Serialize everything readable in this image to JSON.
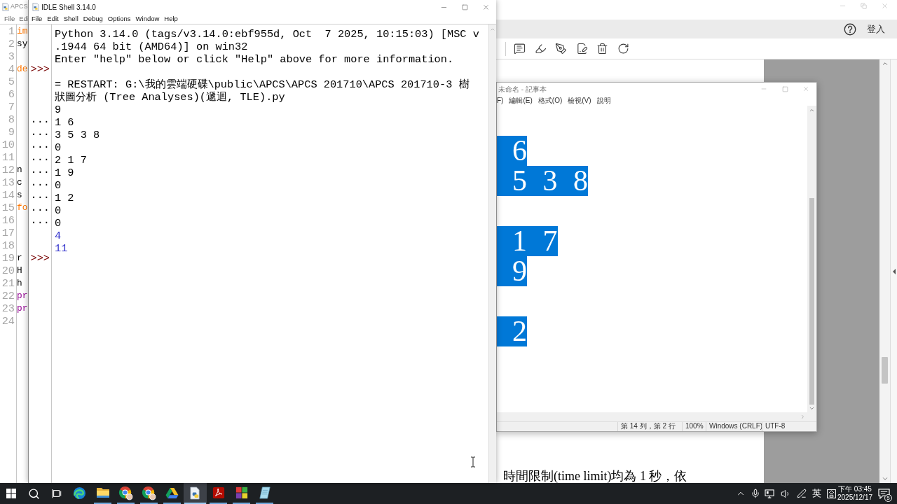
{
  "reader": {
    "account": "登入",
    "page_text": "時間限制(time limit)均為 1 秒，依"
  },
  "notepad": {
    "title": "未命名 - 記事本",
    "menu": [
      "F)",
      "編輯(E)",
      "格式(O)",
      "檢視(V)",
      "說明"
    ],
    "rows": [
      {
        "kind": "blank"
      },
      {
        "kind": "text",
        "text": "6",
        "selected": true
      },
      {
        "kind": "text",
        "text": "5 3 8",
        "selected": true
      },
      {
        "kind": "blank"
      },
      {
        "kind": "text",
        "text": "1 7",
        "selected": true
      },
      {
        "kind": "text",
        "text": "9",
        "selected": true
      },
      {
        "kind": "blank"
      },
      {
        "kind": "text",
        "text": "2",
        "selected": true
      },
      {
        "kind": "blank"
      },
      {
        "kind": "blank"
      }
    ],
    "status": [
      "第 14 列，第 2 行",
      "100%",
      "Windows (CRLF)",
      "UTF-8"
    ]
  },
  "editor_window": {
    "title": "APCS",
    "menu": [
      "File",
      "Edi"
    ],
    "lines": [
      {
        "number": "1",
        "code": "im",
        "kind": "keyword"
      },
      {
        "number": "2",
        "code": "sy",
        "kind": "name"
      },
      {
        "number": "3"
      },
      {
        "number": "4",
        "code": "de",
        "kind": "keyword"
      },
      {
        "number": "5"
      },
      {
        "number": "6"
      },
      {
        "number": "7"
      },
      {
        "number": "8"
      },
      {
        "number": "9"
      },
      {
        "number": "10"
      },
      {
        "number": "11"
      },
      {
        "number": "12",
        "code": "n",
        "kind": "name"
      },
      {
        "number": "13",
        "code": "c",
        "kind": "name"
      },
      {
        "number": "14",
        "code": "s",
        "kind": "name"
      },
      {
        "number": "15",
        "code": "fo",
        "kind": "keyword"
      },
      {
        "number": "16"
      },
      {
        "number": "17"
      },
      {
        "number": "18"
      },
      {
        "number": "19",
        "code": "r",
        "kind": "name"
      },
      {
        "number": "20",
        "code": "H",
        "kind": "name"
      },
      {
        "number": "21",
        "code": "h",
        "kind": "name"
      },
      {
        "number": "22",
        "code": "pr",
        "kind": "builtin"
      },
      {
        "number": "23",
        "code": "pr",
        "kind": "builtin"
      },
      {
        "number": "24"
      }
    ]
  },
  "shell_window": {
    "title": "IDLE Shell 3.14.0",
    "menu": [
      "File",
      "Edit",
      "Shell",
      "Debug",
      "Options",
      "Window",
      "Help"
    ],
    "lines": [
      {
        "kind": "text",
        "text": "Python 3.14.0 (tags/v3.14.0:ebf955d, Oct  7 2025, 10:15:03) [MSC v"
      },
      {
        "kind": "text",
        "text": ".1944 64 bit (AMD64)] on win32"
      },
      {
        "kind": "text",
        "text": "Enter \"help\" below or click \"Help\" above for more information."
      },
      {
        "prompt": {
          "text": ">>>",
          "kind": "primary"
        }
      },
      {
        "kind": "text",
        "text": "= RESTART: G:\\我的雲端硬碟\\public\\APCS\\APCS 201710\\APCS 201710-3 樹"
      },
      {
        "kind": "text",
        "text": "狀圖分析 (Tree Analyses)(遞迴, TLE).py"
      },
      {
        "kind": "text",
        "text": "9"
      },
      {
        "prompt": {
          "text": "...",
          "kind": "continuation"
        },
        "kind": "text",
        "text": "1 6"
      },
      {
        "prompt": {
          "text": "...",
          "kind": "continuation"
        },
        "kind": "text",
        "text": "3 5 3 8"
      },
      {
        "prompt": {
          "text": "...",
          "kind": "continuation"
        },
        "kind": "text",
        "text": "0"
      },
      {
        "prompt": {
          "text": "...",
          "kind": "continuation"
        },
        "kind": "text",
        "text": "2 1 7"
      },
      {
        "prompt": {
          "text": "...",
          "kind": "continuation"
        },
        "kind": "text",
        "text": "1 9"
      },
      {
        "prompt": {
          "text": "...",
          "kind": "continuation"
        },
        "kind": "text",
        "text": "0"
      },
      {
        "prompt": {
          "text": "...",
          "kind": "continuation"
        },
        "kind": "text",
        "text": "1 2"
      },
      {
        "prompt": {
          "text": "...",
          "kind": "continuation"
        },
        "kind": "text",
        "text": "0"
      },
      {
        "prompt": {
          "text": "...",
          "kind": "continuation"
        },
        "kind": "text",
        "text": "0"
      },
      {
        "kind": "output",
        "text": "4"
      },
      {
        "kind": "output",
        "text": "11"
      },
      {
        "prompt": {
          "text": ">>>",
          "kind": "primary"
        }
      }
    ]
  },
  "taskbar": {
    "apps": [
      {
        "kind": "edge",
        "running": false,
        "selected": false
      },
      {
        "kind": "folder",
        "running": true,
        "selected": false
      },
      {
        "kind": "chrome",
        "running": true,
        "selected": false
      },
      {
        "kind": "chrome",
        "running": true,
        "selected": false
      },
      {
        "kind": "drive",
        "running": true,
        "selected": false
      },
      {
        "kind": "python",
        "running": true,
        "selected": true
      },
      {
        "kind": "pdf",
        "running": true,
        "selected": false
      },
      {
        "kind": "tiles",
        "running": true,
        "selected": false
      },
      {
        "kind": "notepad",
        "running": true,
        "selected": false
      }
    ],
    "input_language": "英",
    "time": "下午 03:45",
    "date": "2025/12/17",
    "notifications": "5"
  }
}
